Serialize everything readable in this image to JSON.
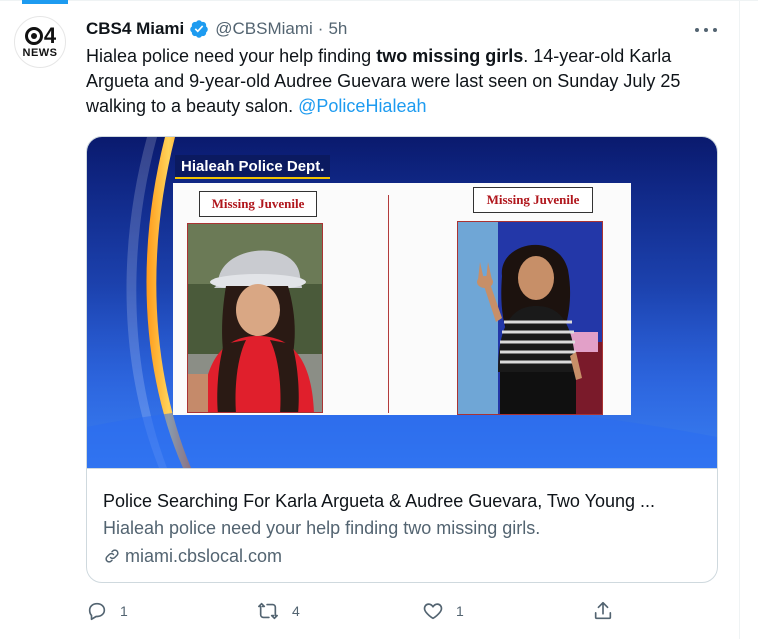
{
  "tweet": {
    "author": {
      "display_name": "CBS4 Miami",
      "handle": "@CBSMiami",
      "separator": "·",
      "time": "5h",
      "verified": true,
      "avatar": {
        "logo_top": "4",
        "logo_bottom": "NEWS"
      }
    },
    "more_icon": "ellipsis-icon",
    "text": {
      "part1": "Hialea police need your help finding ",
      "bold": "two missing girls",
      "part2": ". 14-year-old Karla Argueta and 9-year-old Audree Guevara were last seen on Sunday July 25 walking to a beauty salon. ",
      "mention": "@PoliceHialeah"
    },
    "card": {
      "image": {
        "dept_label": "Hialeah Police Dept.",
        "left_tag": "Missing Juvenile",
        "right_tag": "Missing Juvenile"
      },
      "title": "Police Searching For Karla Argueta & Audree Guevara, Two Young ...",
      "description": "Hialeah police need your help finding two missing girls.",
      "domain": "miami.cbslocal.com"
    },
    "actions": {
      "reply": {
        "icon": "reply-icon",
        "count": "1"
      },
      "retweet": {
        "icon": "retweet-icon",
        "count": "4"
      },
      "like": {
        "icon": "heart-icon",
        "count": "1"
      },
      "share": {
        "icon": "share-icon"
      }
    }
  },
  "colors": {
    "accent": "#1d9bf0",
    "text_primary": "#0f1419",
    "text_secondary": "#536471",
    "border": "#cfd9de"
  }
}
